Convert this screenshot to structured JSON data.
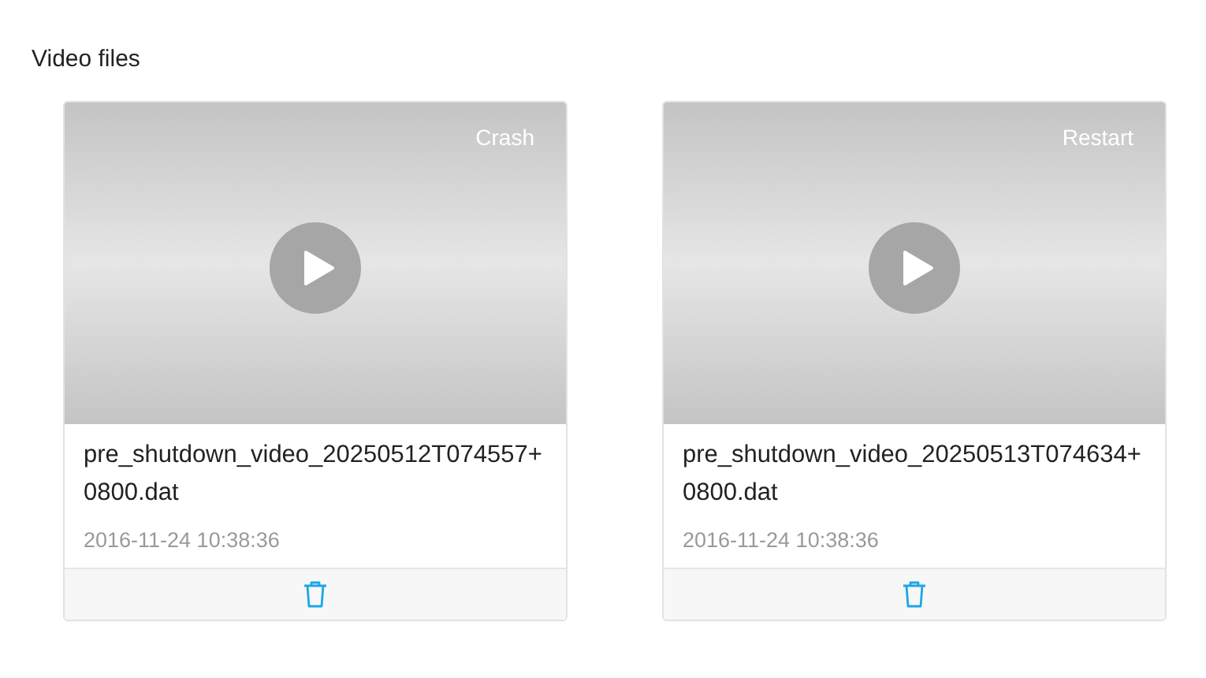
{
  "title": "Video files",
  "videos": [
    {
      "tag": "Crash",
      "filename": "pre_shutdown_video_20250512T074557+0800.dat",
      "date": "2016-11-24 10:38:36"
    },
    {
      "tag": "Restart",
      "filename": "pre_shutdown_video_20250513T074634+0800.dat",
      "date": "2016-11-24 10:38:36"
    }
  ]
}
